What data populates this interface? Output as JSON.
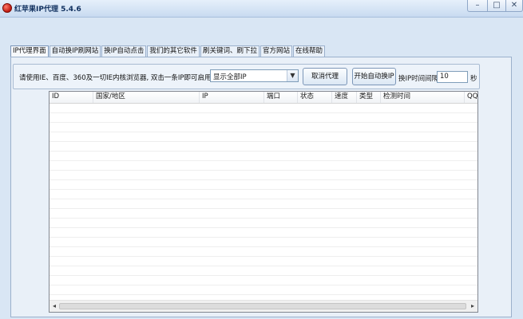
{
  "window": {
    "title": "红苹果IP代理  5.4.6",
    "controls": {
      "minimize": "–",
      "maximize": "□",
      "close": "✕"
    }
  },
  "tabs": [
    {
      "label": "IP代理界面",
      "active": true
    },
    {
      "label": "自动换IP刷网站",
      "active": false
    },
    {
      "label": "换IP自动点击",
      "active": false
    },
    {
      "label": "我们的其它软件",
      "active": false
    },
    {
      "label": "刷关键词、刷下拉",
      "active": false
    },
    {
      "label": "官方网站",
      "active": false
    },
    {
      "label": "在线帮助",
      "active": false
    }
  ],
  "toolbar": {
    "tip": "请使用IE、百度、360及一切IE内核浏览器,  双击一条IP即可启用代理",
    "filter_select": {
      "value": "显示全部IP"
    },
    "cancel_label": "取消代理",
    "auto_label": "开始自动换IP",
    "interval_label": "换IP时间间隔",
    "interval_value": "10",
    "interval_unit": "秒"
  },
  "table": {
    "columns": [
      "ID",
      "国家/地区",
      "IP",
      "端口",
      "状态",
      "速度",
      "类型",
      "检测时间",
      "QQ可"
    ],
    "rows": []
  },
  "scrollbar": {
    "left_arrow": "◂",
    "right_arrow": "▸"
  },
  "icons": {
    "app": "red-apple-icon",
    "dropdown": "chevron-down-icon"
  }
}
